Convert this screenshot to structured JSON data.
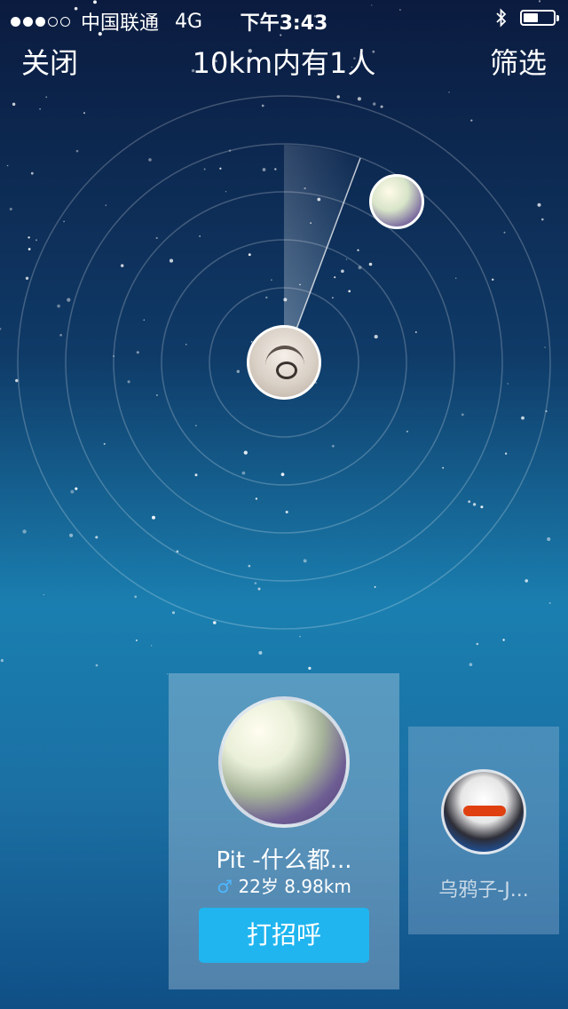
{
  "status_bar": {
    "carrier": "中国联通",
    "network": "4G",
    "time": "下午3:43",
    "signal_icon": "signal-dots-icon",
    "bluetooth_icon": "bluetooth-icon",
    "battery_icon": "battery-icon",
    "battery_level": 0.5
  },
  "nav": {
    "close_label": "关闭",
    "title": "10km内有1人",
    "filter_label": "筛选"
  },
  "radar": {
    "self_avatar_icon": "self-avatar",
    "nearby_avatar_icon": "nearby-user-avatar"
  },
  "cards": {
    "main": {
      "name": "Pit -什么都...",
      "gender_icon": "♂",
      "age": "22岁",
      "distance": "8.98km",
      "button_label": "打招呼"
    },
    "side": {
      "name": "乌鸦子-J..."
    }
  },
  "colors": {
    "accent": "#20b5ef",
    "male": "#4fb7ff"
  }
}
